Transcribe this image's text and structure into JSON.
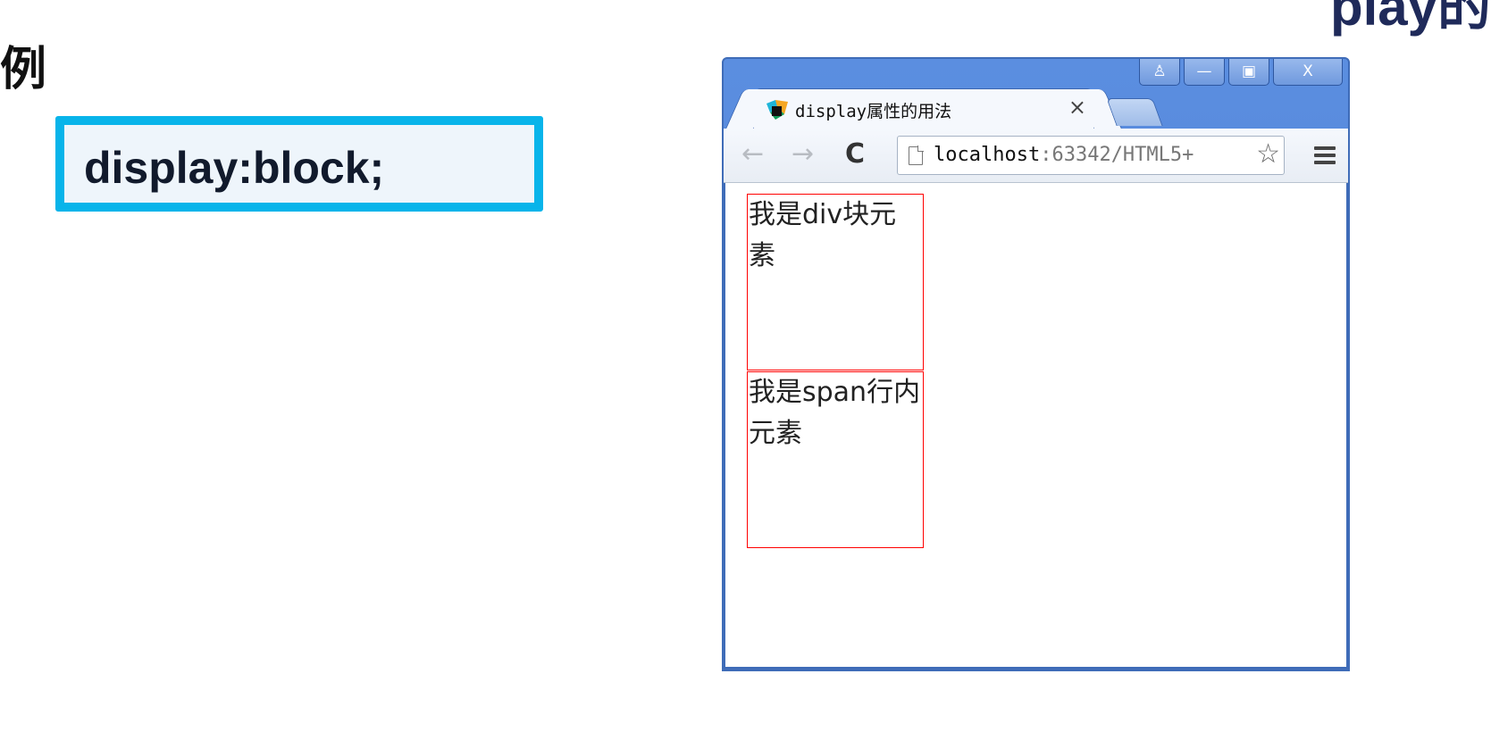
{
  "slide": {
    "heading_char": "例",
    "corner_title_fragment": "play的",
    "code_text": "display:block;"
  },
  "browser": {
    "tab": {
      "title": "display属性的用法",
      "close_label": "×"
    },
    "caption_buttons": {
      "user": "♙",
      "minimize": "—",
      "maximize": "▣",
      "close": "X"
    },
    "toolbar": {
      "back_label": "←",
      "forward_label": "→",
      "reload_label": "C",
      "url_host": "localhost",
      "url_path": ":63342/HTML5+",
      "bookmark_label": "☆"
    },
    "content": {
      "div_text": "我是div块元素",
      "span_text": "我是span行内元素"
    }
  },
  "colors": {
    "code_border": "#08b4ea",
    "code_bg": "#eef5fb",
    "frame_blue": "#4b7fd2",
    "demo_border": "#ff0000",
    "corner_title": "#1f2a5a"
  }
}
